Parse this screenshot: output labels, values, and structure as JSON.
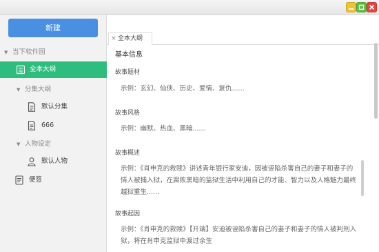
{
  "toolbar": {
    "new_label": "新建"
  },
  "sidebar": {
    "root_label": "当下软件园",
    "items": [
      {
        "label": "全本大纲"
      },
      {
        "label": "分集大纲"
      },
      {
        "label": "默认分集"
      },
      {
        "label": "666"
      },
      {
        "label": "人物设定"
      },
      {
        "label": "默认人物"
      },
      {
        "label": "便签"
      }
    ],
    "active_color": "#2fbd7e"
  },
  "tabs": [
    {
      "label": "全本大纲",
      "close": "×"
    }
  ],
  "content": {
    "section_title": "基本信息",
    "fields": [
      {
        "label": "故事题材",
        "text": "示例：玄幻、仙侠、历史、爱情、复仇......"
      },
      {
        "label": "故事风格",
        "text": "示例：幽默、热血、黑暗......"
      },
      {
        "label": "故事概述",
        "text": "示例：《肖申克的救赎》讲述青年银行家安迪，因被诬陷杀害自己的妻子和妻子的情人被捕入狱，在腐败黑暗的监狱生活中利用自己的才能、智力以及人格魅力最终越狱重生......"
      },
      {
        "label": "故事起因",
        "text": "示例：《肖申克的救赎》【开端】安迪被诬陷杀害自己的妻子和妻子的情人被判刑入狱，将在肖申克监狱中渡过余生"
      }
    ]
  },
  "colors": {
    "new_button": "#4a90e2",
    "win_min": "#f2c230",
    "win_max": "#5bbf3c",
    "win_close": "#e9433e"
  }
}
